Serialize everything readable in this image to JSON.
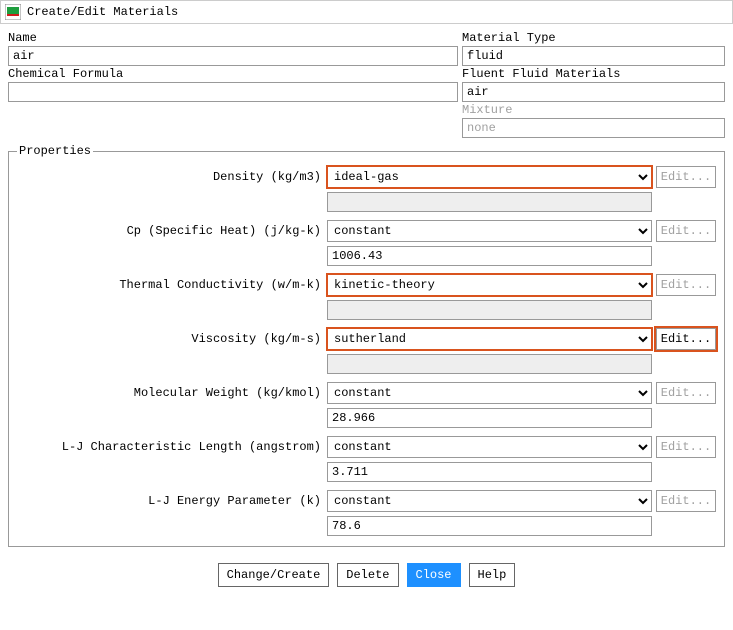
{
  "window": {
    "title": "Create/Edit Materials"
  },
  "fields": {
    "name_label": "Name",
    "name_value": "air",
    "formula_label": "Chemical Formula",
    "formula_value": "",
    "material_type_label": "Material Type",
    "material_type_value": "fluid",
    "fluent_materials_label": "Fluent Fluid Materials",
    "fluent_materials_value": "air",
    "mixture_label": "Mixture",
    "mixture_value": "none"
  },
  "properties_legend": "Properties",
  "edit_label": "Edit...",
  "props": {
    "density": {
      "label": "Density (kg/m3)",
      "method": "ideal-gas",
      "value": "",
      "highlight": true,
      "edit_enabled": false
    },
    "cp": {
      "label": "Cp (Specific Heat) (j/kg-k)",
      "method": "constant",
      "value": "1006.43",
      "highlight": false,
      "edit_enabled": false
    },
    "thermal_cond": {
      "label": "Thermal Conductivity (w/m-k)",
      "method": "kinetic-theory",
      "value": "",
      "highlight": true,
      "edit_enabled": false
    },
    "viscosity": {
      "label": "Viscosity (kg/m-s)",
      "method": "sutherland",
      "value": "",
      "highlight": true,
      "edit_enabled": true
    },
    "mw": {
      "label": "Molecular Weight (kg/kmol)",
      "method": "constant",
      "value": "28.966",
      "highlight": false,
      "edit_enabled": false
    },
    "lj_length": {
      "label": "L-J Characteristic Length (angstrom)",
      "method": "constant",
      "value": "3.711",
      "highlight": false,
      "edit_enabled": false
    },
    "lj_energy": {
      "label": "L-J Energy Parameter (k)",
      "method": "constant",
      "value": "78.6",
      "highlight": false,
      "edit_enabled": false
    }
  },
  "footer": {
    "change_create": "Change/Create",
    "delete": "Delete",
    "close": "Close",
    "help": "Help"
  }
}
